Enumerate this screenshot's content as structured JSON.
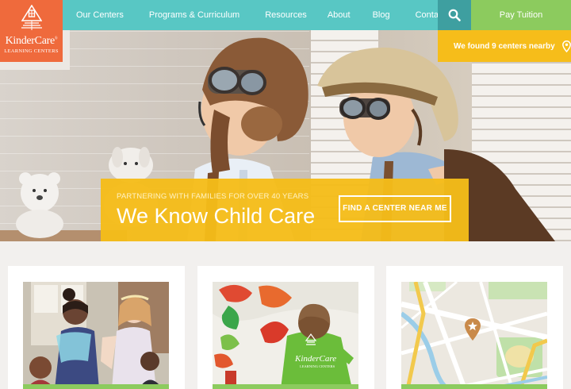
{
  "logo": {
    "brand": "KinderCare",
    "registered": "®",
    "sub": "LEARNING CENTERS"
  },
  "nav": {
    "items": [
      "Our Centers",
      "Programs & Curriculum",
      "Resources",
      "About",
      "Blog",
      "Contact Us"
    ],
    "search_icon": "search-icon",
    "pay_label": "Pay Tuition"
  },
  "locator": {
    "text": "We found 9 centers nearby",
    "icon": "map-pin-icon"
  },
  "hero": {
    "tagline_small": "PARTNERING WITH FAMILIES FOR OVER 40 YEARS",
    "tagline_big": "We Know Child Care",
    "cta_label": "FIND A CENTER NEAR ME"
  },
  "cards": {
    "card2_shirt_logo": "KinderCare",
    "card2_shirt_sub": "LEARNING CENTERS"
  },
  "colors": {
    "teal": "#58c7c4",
    "dark_teal": "#3e9fa0",
    "orange": "#ef6a3c",
    "green": "#8ccb5e",
    "yellow": "#f6bd1a"
  }
}
